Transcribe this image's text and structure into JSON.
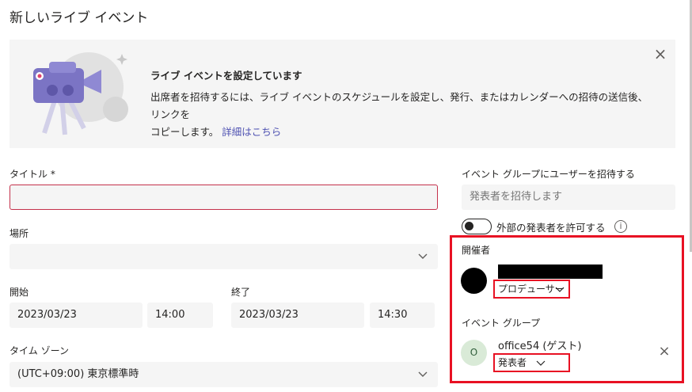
{
  "page": {
    "title": "新しいライブ イベント"
  },
  "banner": {
    "heading": "ライブ イベントを設定しています",
    "body_line1": "出席者を招待するには、ライブ イベントのスケジュールを設定し、発行、またはカレンダーへの招待の送信後、リンクを",
    "body_line2": "コピーします。",
    "link": "詳細はこちら",
    "close_icon": "×"
  },
  "form": {
    "title_label": "タイトル *",
    "title_value": "",
    "location_label": "場所",
    "location_value": "",
    "start_label": "開始",
    "start_date": "2023/03/23",
    "start_time": "14:00",
    "end_label": "終了",
    "end_date": "2023/03/23",
    "end_time": "14:30",
    "timezone_label": "タイム ゾーン",
    "timezone_value": "(UTC+09:00) 東京標準時"
  },
  "group": {
    "invite_label": "イベント グループにユーザーを招待する",
    "invite_placeholder": "発表者を招待します",
    "toggle_label": "外部の発表者を許可する",
    "toggle_on": false,
    "info_icon": "i",
    "organizer_heading": "開催者",
    "organizer_role": "プロデューサー",
    "event_group_heading": "イベント グループ",
    "member_initial": "O",
    "member_name": "office54 (ゲスト)",
    "member_role": "発表者",
    "remove_icon": "×"
  },
  "colors": {
    "accent": "#4f52b2",
    "highlight": "#e81123",
    "error_border": "#c4314b",
    "field_bg": "#f5f5f5"
  }
}
